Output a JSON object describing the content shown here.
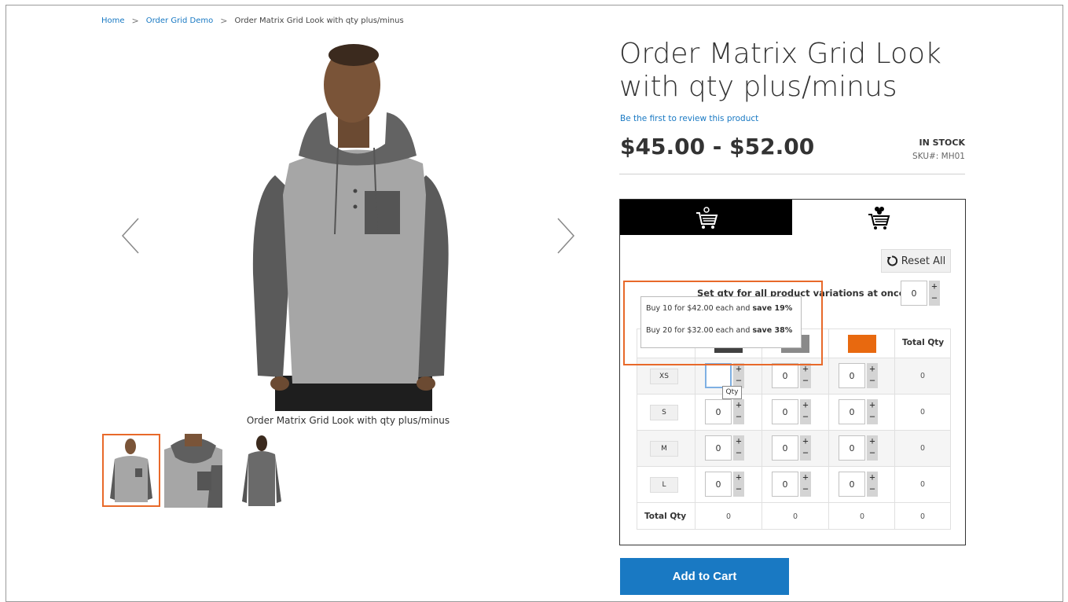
{
  "breadcrumb": {
    "home": "Home",
    "category": "Order Grid Demo",
    "current": "Order Matrix Grid Look with qty plus/minus",
    "separator": ">"
  },
  "gallery": {
    "caption": "Order Matrix Grid Look with qty plus/minus",
    "prev_icon": "chevron-left-icon",
    "next_icon": "chevron-right-icon",
    "thumbnails": [
      "front",
      "detail",
      "back"
    ],
    "active_thumbnail": 0
  },
  "product": {
    "title": "Order Matrix Grid Look with qty plus/minus",
    "review_link": "Be the first to review this product",
    "price": "$45.00 - $52.00",
    "stock": "IN STOCK",
    "sku": "SKU#:  MH01"
  },
  "matrix": {
    "tabs": [
      {
        "icon": "cart-icon",
        "active": true
      },
      {
        "icon": "cart-icon",
        "active": false
      }
    ],
    "reset_label": "Reset All",
    "set_all_label": "Set qty for all product variations at once :",
    "set_all_value": "0",
    "plus": "+",
    "minus": "−",
    "total_qty_label": "Total Qty",
    "colors": [
      "#404040",
      "#8a8a8a",
      "#e8690f"
    ],
    "rows": [
      {
        "size": "XS",
        "values": [
          "",
          "0",
          "0"
        ],
        "total": "0"
      },
      {
        "size": "S",
        "values": [
          "0",
          "0",
          "0"
        ],
        "total": "0"
      },
      {
        "size": "M",
        "values": [
          "0",
          "0",
          "0"
        ],
        "total": "0"
      },
      {
        "size": "L",
        "values": [
          "0",
          "0",
          "0"
        ],
        "total": "0"
      }
    ],
    "column_totals": [
      "0",
      "0",
      "0",
      "0"
    ]
  },
  "tier_prices": {
    "line1": {
      "prefix": "Buy 10 for $42.00 each and ",
      "save": "save 19%"
    },
    "line2": {
      "prefix": "Buy 20 for $32.00 each and ",
      "save": "save 38%"
    }
  },
  "qty_tooltip": "Qty",
  "add_to_cart": "Add to Cart"
}
